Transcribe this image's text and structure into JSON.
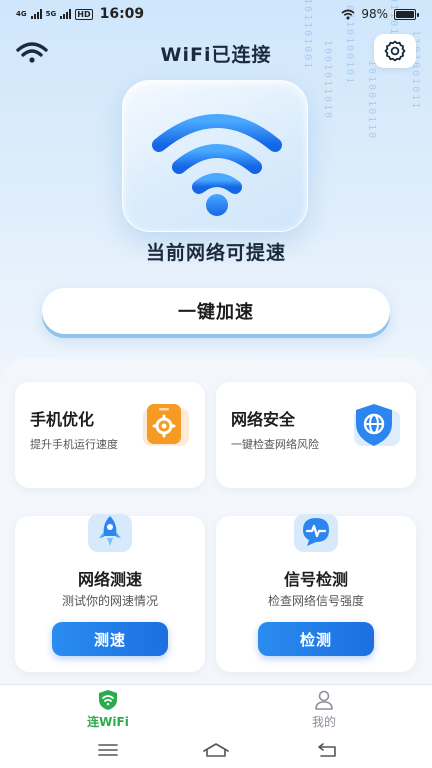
{
  "status_bar": {
    "network_tag_1": "4G",
    "network_tag_2": "5G",
    "hd_badge": "HD",
    "time": "16:09",
    "battery_text": "98%",
    "battery_level": 0.98
  },
  "header": {
    "title": "WiFi已连接",
    "wifi_icon": "wifi-icon",
    "settings_icon": "gear-icon"
  },
  "hero": {
    "icon": "wifi-icon",
    "status_text": "当前网络可提速",
    "boost_button_label": "一键加速"
  },
  "features": {
    "phone_optimize": {
      "title": "手机优化",
      "desc": "提升手机运行速度",
      "icon": "phone-gear-icon"
    },
    "network_security": {
      "title": "网络安全",
      "desc": "一键检查网络风险",
      "icon": "shield-globe-icon"
    },
    "speed_test": {
      "title": "网络测速",
      "desc": "测试你的网速情况",
      "button_label": "测速",
      "icon": "rocket-icon"
    },
    "signal_check": {
      "title": "信号检测",
      "desc": "检查网络信号强度",
      "button_label": "检测",
      "icon": "chat-pulse-icon"
    }
  },
  "tabbar": {
    "tabs": [
      {
        "label": "连WiFi",
        "icon": "wifi-shield-icon",
        "active": true
      },
      {
        "label": "我的",
        "icon": "user-icon",
        "active": false
      }
    ]
  },
  "navbar": {
    "buttons": [
      "menu-icon",
      "home-icon",
      "back-icon"
    ]
  },
  "colors": {
    "accent_blue": "#1c6fe0",
    "active_green": "#2bab4b",
    "hero_bg": "#cfe6fb"
  }
}
